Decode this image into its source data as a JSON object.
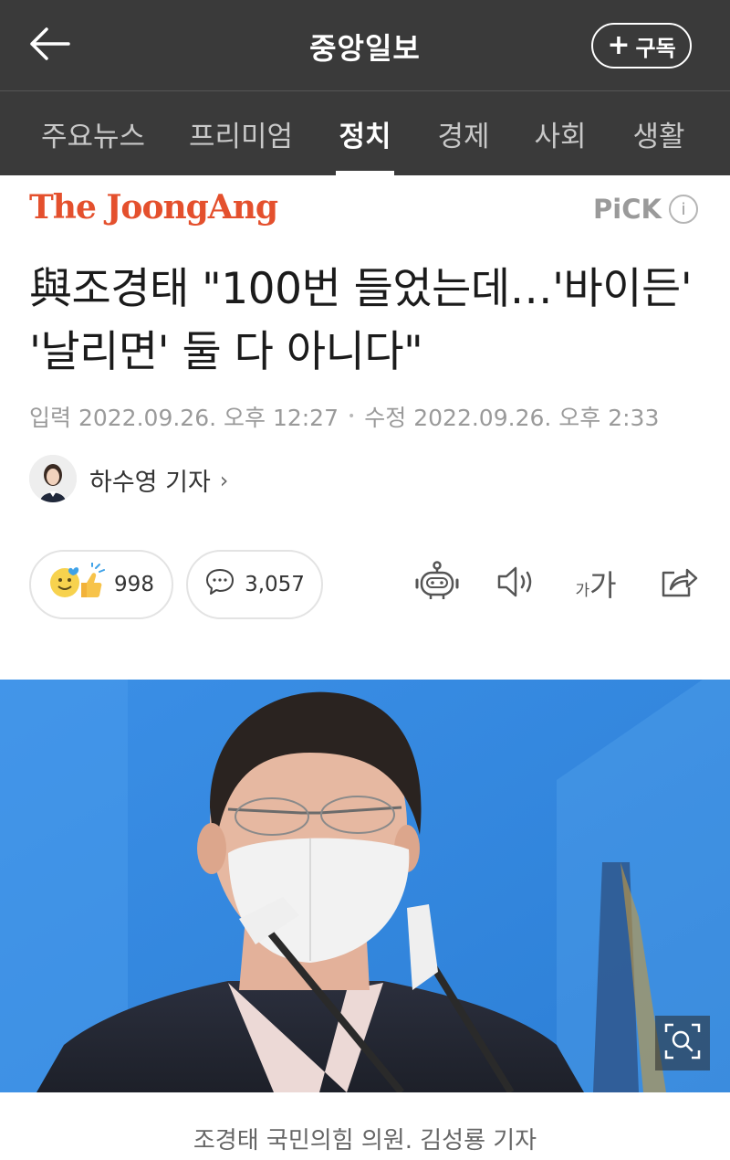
{
  "header": {
    "title": "중앙일보",
    "subscribe_label": "구독",
    "back_icon": "arrow-left-icon"
  },
  "tabs": [
    {
      "label": "주요뉴스",
      "active": false
    },
    {
      "label": "프리미엄",
      "active": false
    },
    {
      "label": "정치",
      "active": true
    },
    {
      "label": "경제",
      "active": false
    },
    {
      "label": "사회",
      "active": false
    },
    {
      "label": "생활",
      "active": false
    }
  ],
  "publisher": {
    "name": "The JoongAng",
    "badge": "PiCK",
    "brand_color": "#e4502d"
  },
  "article": {
    "headline": "與조경태 \"100번 들었는데…'바이든' '날리면' 둘 다 아니다\"",
    "input_label": "입력",
    "input_date": "2022.09.26. 오후 12:27",
    "modified_label": "수정",
    "modified_date": "2022.09.26. 오후 2:33",
    "author": "하수영 기자",
    "caption": "조경태 국민의힘 의원. 김성룡 기자"
  },
  "reactions": {
    "likes": "998",
    "comments": "3,057"
  },
  "toolbar": {
    "font_size_small": "가",
    "font_size_large": "가"
  }
}
